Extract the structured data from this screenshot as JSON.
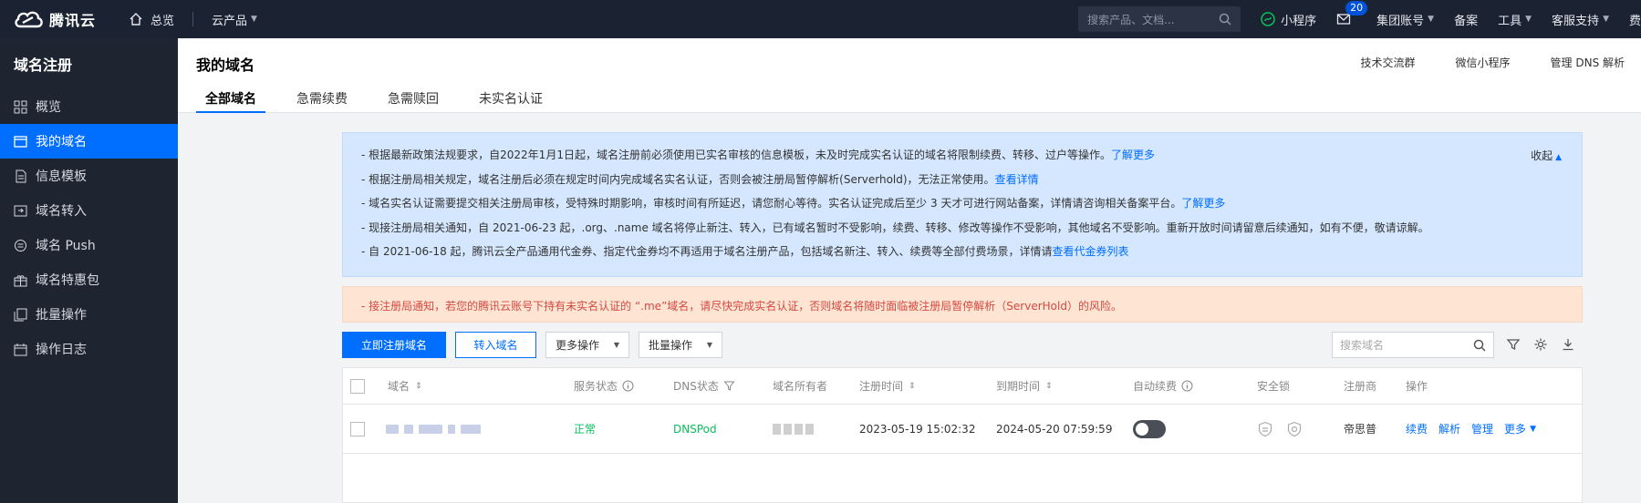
{
  "topbar": {
    "brand": "腾讯云",
    "overview": "总览",
    "products": "云产品",
    "search_placeholder": "搜索产品、文档...",
    "miniprogram": "小程序",
    "mail_badge": "20",
    "group_account": "集团账号",
    "beian": "备案",
    "tools": "工具",
    "support": "客服支持",
    "fee": "费"
  },
  "sidebar": {
    "title": "域名注册",
    "items": [
      {
        "label": "概览",
        "icon": "grid-icon"
      },
      {
        "label": "我的域名",
        "icon": "window-icon"
      },
      {
        "label": "信息模板",
        "icon": "document-icon"
      },
      {
        "label": "域名转入",
        "icon": "transfer-icon"
      },
      {
        "label": "域名 Push",
        "icon": "push-icon"
      },
      {
        "label": "域名特惠包",
        "icon": "package-icon"
      },
      {
        "label": "批量操作",
        "icon": "batch-icon"
      },
      {
        "label": "操作日志",
        "icon": "calendar-icon"
      }
    ],
    "active_index": 1
  },
  "header": {
    "title": "我的域名",
    "links": [
      "技术交流群",
      "微信小程序",
      "管理 DNS 解析"
    ],
    "tabs": [
      "全部域名",
      "急需续费",
      "急需赎回",
      "未实名认证"
    ],
    "active_tab": 0
  },
  "notice": {
    "collapse_label": "收起",
    "lines": [
      {
        "text": "- 根据最新政策法规要求，自2022年1月1日起，域名注册前必须使用已实名审核的信息模板，未及时完成实名认证的域名将限制续费、转移、过户等操作。",
        "link": "了解更多"
      },
      {
        "text": "- 根据注册局相关规定，域名注册后必须在规定时间内完成域名实名认证，否则会被注册局暂停解析(Serverhold)，无法正常使用。",
        "link": "查看详情"
      },
      {
        "text": "- 域名实名认证需要提交相关注册局审核，受特殊时期影响，审核时间有所延迟，请您耐心等待。实名认证完成后至少 3 天才可进行网站备案，详情请咨询相关备案平台。",
        "link": "了解更多"
      },
      {
        "text": "- 现接注册局相关通知，自 2021-06-23 起，.org、.name 域名将停止新注、转入，已有域名暂时不受影响，续费、转移、修改等操作不受影响，其他域名不受影响。重新开放时间请留意后续通知，如有不便，敬请谅解。",
        "link": ""
      },
      {
        "text": "- 自 2021-06-18 起，腾讯云全产品通用代金券、指定代金券均不再适用于域名注册产品，包括域名新注、转入、续费等全部付费场景，详情请",
        "link": "查看代金券列表"
      }
    ],
    "warning": "- 接注册局通知，若您的腾讯云账号下持有未实名认证的 “.me”域名，请尽快完成实名认证，否则域名将随时面临被注册局暂停解析（ServerHold）的风险。"
  },
  "toolbar": {
    "register": "立即注册域名",
    "transfer": "转入域名",
    "more_ops": "更多操作",
    "batch_ops": "批量操作",
    "search_placeholder": "搜索域名"
  },
  "table": {
    "columns": {
      "domain": "域名",
      "service_status": "服务状态",
      "dns_status": "DNS状态",
      "owner": "域名所有者",
      "register_time": "注册时间",
      "expire_time": "到期时间",
      "auto_renew": "自动续费",
      "security_lock": "安全锁",
      "registrar": "注册商",
      "actions": "操作"
    },
    "rows": [
      {
        "service_status": "正常",
        "dns_status": "DNSPod",
        "register_time": "2023-05-19 15:02:32",
        "expire_time": "2024-05-20 07:59:59",
        "registrar": "帝思普",
        "actions": [
          "续费",
          "解析",
          "管理",
          "更多"
        ]
      }
    ]
  },
  "colors": {
    "topbar_bg": "#1b2232",
    "sidebar_bg": "#1e2430",
    "accent": "#006eff",
    "status_ok": "#0abf5b",
    "warning_text": "#d54941"
  }
}
